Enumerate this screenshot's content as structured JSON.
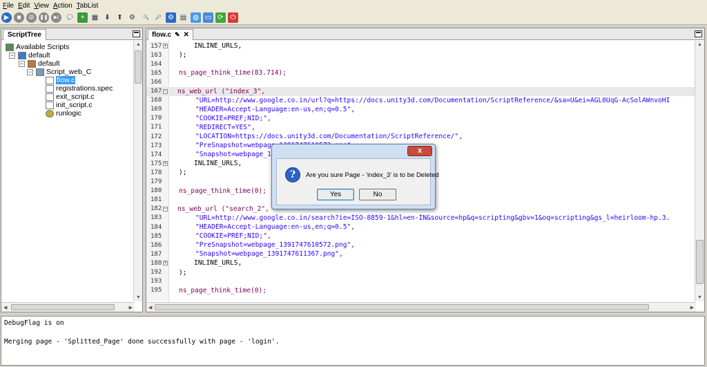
{
  "menu": [
    {
      "label": "File",
      "u": "F",
      "rest": "ile"
    },
    {
      "label": "Edit",
      "u": "E",
      "rest": "dit"
    },
    {
      "label": "View",
      "u": "V",
      "rest": "iew"
    },
    {
      "label": "Action",
      "u": "A",
      "rest": "ction"
    },
    {
      "label": "TabList",
      "u": "T",
      "rest": "abList"
    }
  ],
  "toolbar_icons": [
    {
      "name": "start-icon",
      "glyph": "▶",
      "bg": "#2a6ac8"
    },
    {
      "name": "stop-icon",
      "glyph": "■",
      "bg": "#8a8a8a"
    },
    {
      "name": "cancel-icon",
      "glyph": "⊘",
      "bg": "#8a8a8a"
    },
    {
      "name": "pause-icon",
      "glyph": "❚❚",
      "bg": "#8a8a8a"
    },
    {
      "name": "step-icon",
      "glyph": "▶|",
      "bg": "#8a8a8a"
    },
    {
      "name": "comment-icon",
      "glyph": "💬",
      "bg": "none"
    },
    {
      "name": "add-page-icon",
      "glyph": "+",
      "bg": "#3a9a3a"
    },
    {
      "name": "grid-icon",
      "glyph": "▦",
      "bg": "none"
    },
    {
      "name": "arrow-down-icon",
      "glyph": "⬇",
      "bg": "none"
    },
    {
      "name": "arrow-up-icon",
      "glyph": "⬆",
      "bg": "none"
    },
    {
      "name": "record-icon",
      "glyph": "⚙",
      "bg": "none"
    },
    {
      "name": "find-icon",
      "glyph": "🔍",
      "bg": "none"
    },
    {
      "name": "replace-icon",
      "glyph": "🔎",
      "bg": "none"
    },
    {
      "name": "settings-icon",
      "glyph": "⚙",
      "bg": "#2a6ac8"
    },
    {
      "name": "document-icon",
      "glyph": "▤",
      "bg": "none"
    },
    {
      "name": "globe-icon",
      "glyph": "◍",
      "bg": "#4a9ae8"
    },
    {
      "name": "window-icon",
      "glyph": "▭",
      "bg": "#4a8ad8"
    },
    {
      "name": "refresh-icon",
      "glyph": "⟳",
      "bg": "#3aaa3a"
    },
    {
      "name": "exit-icon",
      "glyph": "⏻",
      "bg": "#d83a3a"
    }
  ],
  "left_panel": {
    "tab": "ScriptTree",
    "tree": [
      {
        "label": "Available Scripts",
        "depth": 0,
        "icon": "scripts-icon",
        "exp": ""
      },
      {
        "label": "default",
        "depth": 1,
        "icon": "folder-blue-icon",
        "exp": "−"
      },
      {
        "label": "default",
        "depth": 2,
        "icon": "folder-brown-icon",
        "exp": "−"
      },
      {
        "label": "Script_web_C",
        "depth": 3,
        "icon": "script-folder-icon",
        "exp": "−"
      },
      {
        "label": "flow.c",
        "depth": 4,
        "icon": "file-icon",
        "exp": "",
        "selected": true
      },
      {
        "label": "registrations.spec",
        "depth": 4,
        "icon": "file-icon",
        "exp": ""
      },
      {
        "label": "exit_script.c",
        "depth": 4,
        "icon": "file-icon",
        "exp": ""
      },
      {
        "label": "init_script.c",
        "depth": 4,
        "icon": "file-icon",
        "exp": ""
      },
      {
        "label": "runlogic",
        "depth": 4,
        "icon": "runlogic-icon",
        "exp": ""
      }
    ]
  },
  "editor": {
    "tab": "flow.c",
    "lines": [
      {
        "n": "157",
        "fold": "+",
        "indent": 2,
        "text": "INLINE_URLS,",
        "kind": "plain"
      },
      {
        "n": "163",
        "fold": "",
        "indent": 1,
        "text": ");",
        "kind": "plain"
      },
      {
        "n": "164",
        "fold": "",
        "indent": 0,
        "text": "",
        "kind": "plain"
      },
      {
        "n": "165",
        "fold": "",
        "indent": 1,
        "text": "ns_page_think_time(83.714);",
        "kind": "kw"
      },
      {
        "n": "166",
        "fold": "",
        "indent": 0,
        "text": "",
        "kind": "plain"
      },
      {
        "n": "167",
        "fold": "−",
        "indent": 1,
        "text": "ns_web_url (\"index_3\",",
        "kind": "kw",
        "hl": true
      },
      {
        "n": "168",
        "fold": "",
        "indent": 2,
        "text": "\"URL=http://www.google.co.in/url?q=https://docs.unity3d.com/Documentation/ScriptReference/&sa=U&ei=AGL0UqG-AcSolAWnvoHI",
        "kind": "str"
      },
      {
        "n": "169",
        "fold": "",
        "indent": 2,
        "text": "\"HEADER=Accept-Language:en-us,en;q=0.5\",",
        "kind": "str"
      },
      {
        "n": "170",
        "fold": "",
        "indent": 2,
        "text": "\"COOKIE=PREF;NID;\",",
        "kind": "str"
      },
      {
        "n": "171",
        "fold": "",
        "indent": 2,
        "text": "\"REDIRECT=YES\",",
        "kind": "str"
      },
      {
        "n": "172",
        "fold": "",
        "indent": 2,
        "text": "\"LOCATION=https://docs.unity3d.com/Documentation/ScriptReference/\",",
        "kind": "str"
      },
      {
        "n": "173",
        "fold": "",
        "indent": 2,
        "text": "\"PreSnapshot=webpage_1391747610572.png\",",
        "kind": "str"
      },
      {
        "n": "174",
        "fold": "",
        "indent": 2,
        "text": "\"Snapshot=webpage_1391747611367.png\",",
        "kind": "str"
      },
      {
        "n": "175",
        "fold": "+",
        "indent": 2,
        "text": "INLINE_URLS,",
        "kind": "plain"
      },
      {
        "n": "178",
        "fold": "",
        "indent": 1,
        "text": ");",
        "kind": "plain"
      },
      {
        "n": "179",
        "fold": "",
        "indent": 0,
        "text": "",
        "kind": "plain"
      },
      {
        "n": "180",
        "fold": "",
        "indent": 1,
        "text": "ns_page_think_time(0);",
        "kind": "kw"
      },
      {
        "n": "181",
        "fold": "",
        "indent": 0,
        "text": "",
        "kind": "plain"
      },
      {
        "n": "182",
        "fold": "−",
        "indent": 1,
        "text": "ns_web_url (\"search_2\",",
        "kind": "kw"
      },
      {
        "n": "183",
        "fold": "",
        "indent": 2,
        "text": "\"URL=http://www.google.co.in/search?ie=ISO-8859-1&hl=en-IN&source=hp&q=scripting&gbv=1&oq=scripting&gs_l=heirloom-hp.3.",
        "kind": "str"
      },
      {
        "n": "184",
        "fold": "",
        "indent": 2,
        "text": "\"HEADER=Accept-Language:en-us,en;q=0.5\",",
        "kind": "str"
      },
      {
        "n": "185",
        "fold": "",
        "indent": 2,
        "text": "\"COOKIE=PREF;NID;\",",
        "kind": "str"
      },
      {
        "n": "186",
        "fold": "",
        "indent": 2,
        "text": "\"PreSnapshot=webpage_1391747610572.png\",",
        "kind": "str"
      },
      {
        "n": "187",
        "fold": "",
        "indent": 2,
        "text": "\"Snapshot=webpage_1391747611367.png\",",
        "kind": "str"
      },
      {
        "n": "188",
        "fold": "+",
        "indent": 2,
        "text": "INLINE_URLS,",
        "kind": "plain"
      },
      {
        "n": "192",
        "fold": "",
        "indent": 1,
        "text": ");",
        "kind": "plain"
      },
      {
        "n": "193",
        "fold": "",
        "indent": 0,
        "text": "",
        "kind": "plain"
      },
      {
        "n": "195",
        "fold": "",
        "indent": 1,
        "text": "ns_page_think_time(0);",
        "kind": "kw"
      }
    ]
  },
  "console": {
    "lines": [
      "DebugFlag is on",
      "",
      "Merging page - 'Splitted_Page' done successfully with page - 'login'."
    ]
  },
  "dialog": {
    "message": "Are you sure Page - 'index_3' is to be Deleted",
    "yes_label": "Yes",
    "no_label": "No",
    "close_glyph": "x"
  },
  "colors": {
    "keyword": "#7f0055",
    "string": "#2a00ff",
    "selection": "#3399ff"
  }
}
